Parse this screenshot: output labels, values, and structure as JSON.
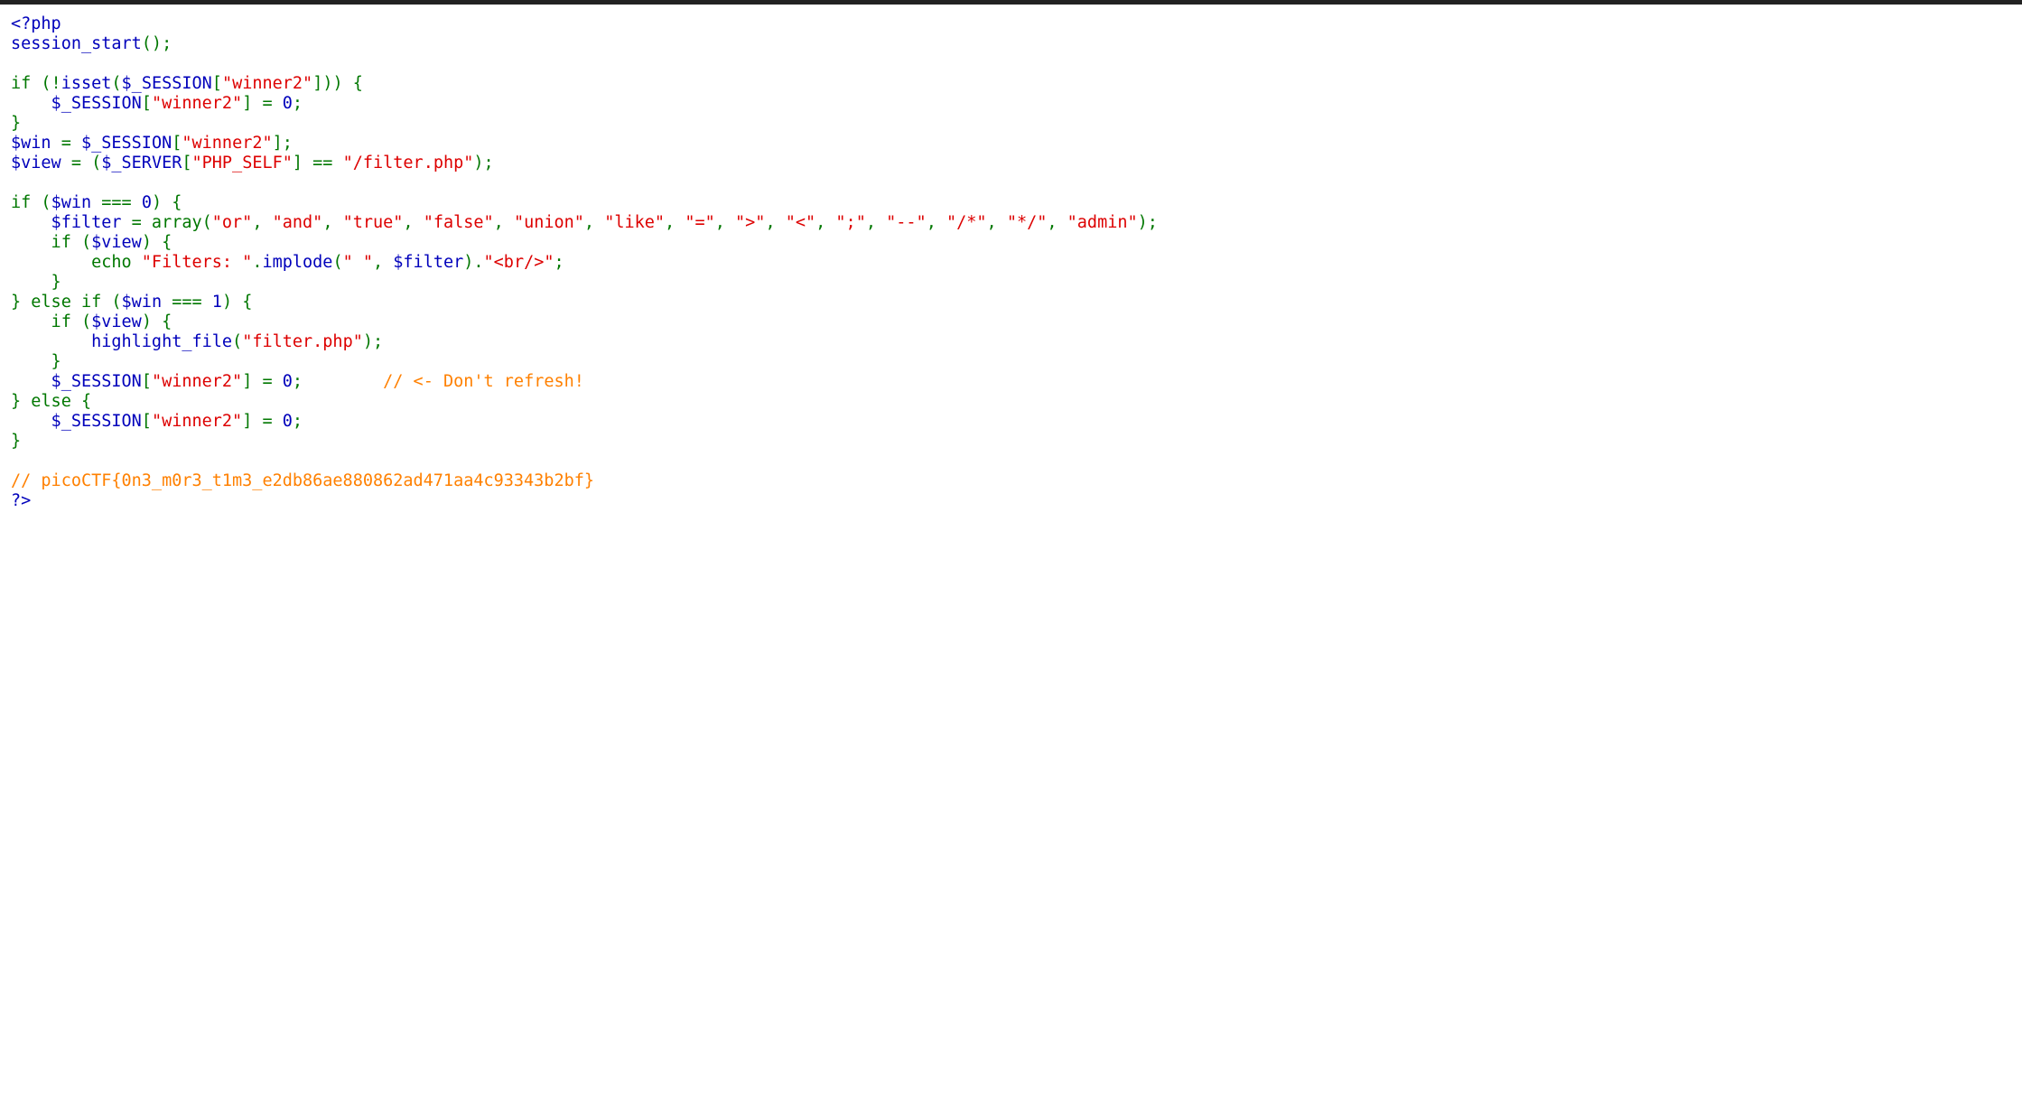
{
  "colors": {
    "default": "#0000BB",
    "keyword": "#007700",
    "string": "#DD0000",
    "comment": "#FF8000"
  },
  "code_lines": [
    [
      {
        "t": "default",
        "v": "<?php"
      }
    ],
    [
      {
        "t": "default",
        "v": "session_start"
      },
      {
        "t": "keyword",
        "v": "();"
      }
    ],
    [],
    [
      {
        "t": "keyword",
        "v": "if (!"
      },
      {
        "t": "default",
        "v": "isset"
      },
      {
        "t": "keyword",
        "v": "("
      },
      {
        "t": "default",
        "v": "$_SESSION"
      },
      {
        "t": "keyword",
        "v": "["
      },
      {
        "t": "string",
        "v": "\"winner2\""
      },
      {
        "t": "keyword",
        "v": "])) {"
      }
    ],
    [
      {
        "t": "default",
        "v": "    $_SESSION"
      },
      {
        "t": "keyword",
        "v": "["
      },
      {
        "t": "string",
        "v": "\"winner2\""
      },
      {
        "t": "keyword",
        "v": "] = "
      },
      {
        "t": "default",
        "v": "0"
      },
      {
        "t": "keyword",
        "v": ";"
      }
    ],
    [
      {
        "t": "keyword",
        "v": "}"
      }
    ],
    [
      {
        "t": "default",
        "v": "$win "
      },
      {
        "t": "keyword",
        "v": "= "
      },
      {
        "t": "default",
        "v": "$_SESSION"
      },
      {
        "t": "keyword",
        "v": "["
      },
      {
        "t": "string",
        "v": "\"winner2\""
      },
      {
        "t": "keyword",
        "v": "];"
      }
    ],
    [
      {
        "t": "default",
        "v": "$view "
      },
      {
        "t": "keyword",
        "v": "= ("
      },
      {
        "t": "default",
        "v": "$_SERVER"
      },
      {
        "t": "keyword",
        "v": "["
      },
      {
        "t": "string",
        "v": "\"PHP_SELF\""
      },
      {
        "t": "keyword",
        "v": "] == "
      },
      {
        "t": "string",
        "v": "\"/filter.php\""
      },
      {
        "t": "keyword",
        "v": ");"
      }
    ],
    [],
    [
      {
        "t": "keyword",
        "v": "if ("
      },
      {
        "t": "default",
        "v": "$win "
      },
      {
        "t": "keyword",
        "v": "=== "
      },
      {
        "t": "default",
        "v": "0"
      },
      {
        "t": "keyword",
        "v": ") {"
      }
    ],
    [
      {
        "t": "default",
        "v": "    $filter "
      },
      {
        "t": "keyword",
        "v": "= array("
      },
      {
        "t": "string",
        "v": "\"or\""
      },
      {
        "t": "keyword",
        "v": ", "
      },
      {
        "t": "string",
        "v": "\"and\""
      },
      {
        "t": "keyword",
        "v": ", "
      },
      {
        "t": "string",
        "v": "\"true\""
      },
      {
        "t": "keyword",
        "v": ", "
      },
      {
        "t": "string",
        "v": "\"false\""
      },
      {
        "t": "keyword",
        "v": ", "
      },
      {
        "t": "string",
        "v": "\"union\""
      },
      {
        "t": "keyword",
        "v": ", "
      },
      {
        "t": "string",
        "v": "\"like\""
      },
      {
        "t": "keyword",
        "v": ", "
      },
      {
        "t": "string",
        "v": "\"=\""
      },
      {
        "t": "keyword",
        "v": ", "
      },
      {
        "t": "string",
        "v": "\">\""
      },
      {
        "t": "keyword",
        "v": ", "
      },
      {
        "t": "string",
        "v": "\"<\""
      },
      {
        "t": "keyword",
        "v": ", "
      },
      {
        "t": "string",
        "v": "\";\""
      },
      {
        "t": "keyword",
        "v": ", "
      },
      {
        "t": "string",
        "v": "\"--\""
      },
      {
        "t": "keyword",
        "v": ", "
      },
      {
        "t": "string",
        "v": "\"/*\""
      },
      {
        "t": "keyword",
        "v": ", "
      },
      {
        "t": "string",
        "v": "\"*/\""
      },
      {
        "t": "keyword",
        "v": ", "
      },
      {
        "t": "string",
        "v": "\"admin\""
      },
      {
        "t": "keyword",
        "v": ");"
      }
    ],
    [
      {
        "t": "keyword",
        "v": "    if ("
      },
      {
        "t": "default",
        "v": "$view"
      },
      {
        "t": "keyword",
        "v": ") {"
      }
    ],
    [
      {
        "t": "keyword",
        "v": "        echo "
      },
      {
        "t": "string",
        "v": "\"Filters: \""
      },
      {
        "t": "keyword",
        "v": "."
      },
      {
        "t": "default",
        "v": "implode"
      },
      {
        "t": "keyword",
        "v": "("
      },
      {
        "t": "string",
        "v": "\" \""
      },
      {
        "t": "keyword",
        "v": ", "
      },
      {
        "t": "default",
        "v": "$filter"
      },
      {
        "t": "keyword",
        "v": ")."
      },
      {
        "t": "string",
        "v": "\"<br/>\""
      },
      {
        "t": "keyword",
        "v": ";"
      }
    ],
    [
      {
        "t": "keyword",
        "v": "    }"
      }
    ],
    [
      {
        "t": "keyword",
        "v": "} else if ("
      },
      {
        "t": "default",
        "v": "$win "
      },
      {
        "t": "keyword",
        "v": "=== "
      },
      {
        "t": "default",
        "v": "1"
      },
      {
        "t": "keyword",
        "v": ") {"
      }
    ],
    [
      {
        "t": "keyword",
        "v": "    if ("
      },
      {
        "t": "default",
        "v": "$view"
      },
      {
        "t": "keyword",
        "v": ") {"
      }
    ],
    [
      {
        "t": "default",
        "v": "        highlight_file"
      },
      {
        "t": "keyword",
        "v": "("
      },
      {
        "t": "string",
        "v": "\"filter.php\""
      },
      {
        "t": "keyword",
        "v": ");"
      }
    ],
    [
      {
        "t": "keyword",
        "v": "    }"
      }
    ],
    [
      {
        "t": "default",
        "v": "    $_SESSION"
      },
      {
        "t": "keyword",
        "v": "["
      },
      {
        "t": "string",
        "v": "\"winner2\""
      },
      {
        "t": "keyword",
        "v": "] = "
      },
      {
        "t": "default",
        "v": "0"
      },
      {
        "t": "keyword",
        "v": ";        "
      },
      {
        "t": "comment",
        "v": "// <- Don't refresh!"
      }
    ],
    [
      {
        "t": "keyword",
        "v": "} else {"
      }
    ],
    [
      {
        "t": "default",
        "v": "    $_SESSION"
      },
      {
        "t": "keyword",
        "v": "["
      },
      {
        "t": "string",
        "v": "\"winner2\""
      },
      {
        "t": "keyword",
        "v": "] = "
      },
      {
        "t": "default",
        "v": "0"
      },
      {
        "t": "keyword",
        "v": ";"
      }
    ],
    [
      {
        "t": "keyword",
        "v": "}"
      }
    ],
    [],
    [
      {
        "t": "comment",
        "v": "// picoCTF{0n3_m0r3_t1m3_e2db86ae880862ad471aa4c93343b2bf}"
      }
    ],
    [
      {
        "t": "default",
        "v": "?>"
      }
    ]
  ]
}
